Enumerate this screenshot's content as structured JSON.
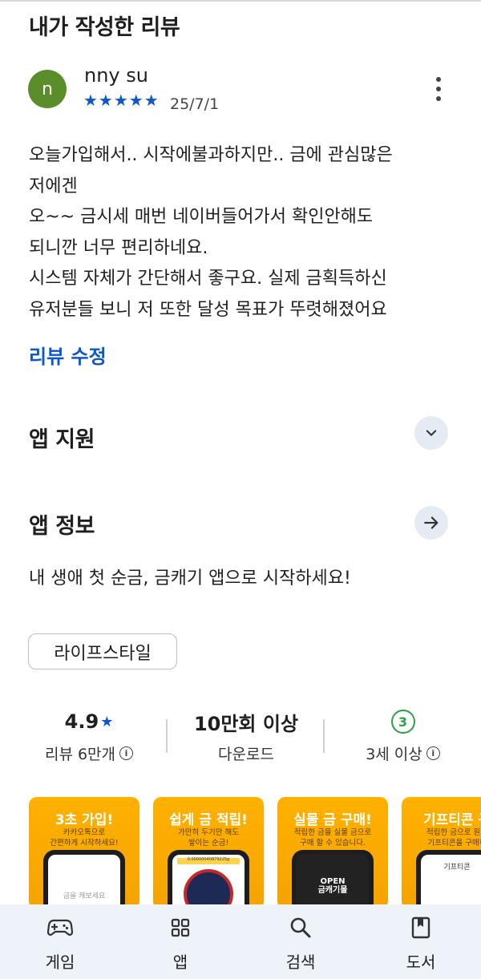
{
  "my_review": {
    "section_title": "내가 작성한 리뷰",
    "avatar_letter": "n",
    "reviewer_name": "nny su",
    "rating": 5,
    "stars": "★★★★★",
    "date": "25/7/1",
    "body": "오늘가입해서..  시작에불과하지만.. 금에 관심많은\n저에겐\n오~~ 금시세 매번 네이버들어가서 확인안해도\n되니깐 너무 편리하네요.\n시스템 자체가 간단해서 좋구요. 실제 금획득하신\n유저분들 보니 저 또한 달성 목표가 뚜렷해졌어요",
    "edit_label": "리뷰 수정"
  },
  "app_support": {
    "title": "앱 지원",
    "icon": "chevron-down-icon"
  },
  "app_info": {
    "title": "앱 정보",
    "icon": "arrow-right-icon",
    "tagline": "내 생애 첫 순금, 금캐기 앱으로 시작하세요!",
    "category": "라이프스타일"
  },
  "stats": {
    "rating_value": "4.9",
    "rating_star": "★",
    "reviews_label": "리뷰 6만개",
    "downloads_value": "10만회 이상",
    "downloads_label": "다운로드",
    "age_badge": "3",
    "age_label": "3세 이상",
    "info_icon_glyph": "i"
  },
  "screenshots": [
    {
      "title": "3초 가입!",
      "subtitle": "카카오톡으로\n간편하게 시작하세요!",
      "screen_text": "금을 캐보세요"
    },
    {
      "title": "쉽게 금 적립!",
      "subtitle": "가만히 두기만 해도\n쌓이는 순금!",
      "screen_text": "0.00000040879225g"
    },
    {
      "title": "실물 금 구매!",
      "subtitle": "적립한 금을 실물 금으로\n구매 할 수 있습니다.",
      "screen_text": "OPEN\n금캐기몰"
    },
    {
      "title": "기프티콘 구",
      "subtitle": "적립한 금으로 원하\n기프티콘을 구매하",
      "screen_text": "기프티콘"
    }
  ],
  "bottom_nav": [
    {
      "label": "게임",
      "icon": "gamepad-icon"
    },
    {
      "label": "앱",
      "icon": "apps-grid-icon"
    },
    {
      "label": "검색",
      "icon": "search-icon"
    },
    {
      "label": "도서",
      "icon": "book-icon"
    }
  ],
  "colors": {
    "accent": "#0b57d0",
    "avatar_bg": "#5b8e2a",
    "age_green": "#2e9f46",
    "nav_bg": "#eef2f9",
    "screenshot_orange": "#ffb100"
  }
}
